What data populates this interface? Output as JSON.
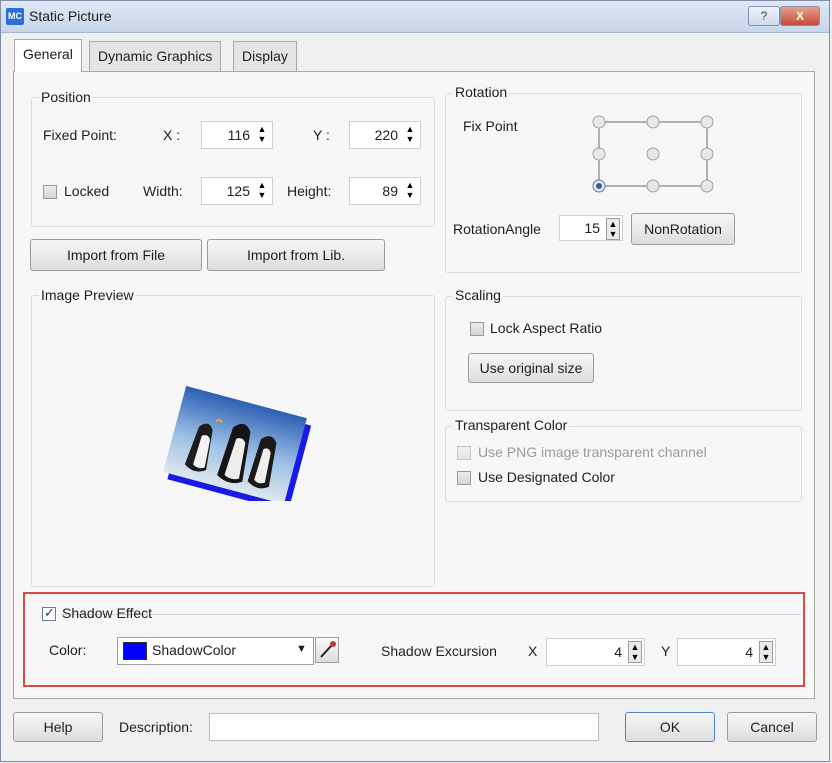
{
  "window": {
    "app_icon_text": "MC",
    "title": "Static Picture",
    "help_label": "?",
    "close_label": "X"
  },
  "tabs": [
    {
      "label": "General",
      "active": true
    },
    {
      "label": "Dynamic Graphics",
      "active": false
    },
    {
      "label": "Display",
      "active": false
    }
  ],
  "position": {
    "title": "Position",
    "fixed_point_label": "Fixed Point:",
    "x_label": "X :",
    "x_value": "116",
    "y_label": "Y :",
    "y_value": "220",
    "locked_label": "Locked",
    "locked_checked": false,
    "width_label": "Width:",
    "width_value": "125",
    "height_label": "Height:",
    "height_value": "89"
  },
  "import": {
    "from_file_label": "Import from File",
    "from_lib_label": "Import from Lib."
  },
  "rotation": {
    "title": "Rotation",
    "fix_point_label": "Fix Point",
    "selected_point": "bottom-left",
    "angle_label": "RotationAngle",
    "angle_value": "15",
    "non_rotation_label": "NonRotation"
  },
  "image_preview": {
    "title": "Image Preview"
  },
  "scaling": {
    "title": "Scaling",
    "lock_aspect_label": "Lock Aspect Ratio",
    "lock_aspect_checked": false,
    "original_size_label": "Use original size"
  },
  "transparent": {
    "title": "Transparent Color",
    "png_channel_label": "Use PNG image transparent channel",
    "png_channel_enabled": false,
    "designated_label": "Use Designated Color",
    "designated_checked": false
  },
  "shadow": {
    "effect_label": "Shadow Effect",
    "effect_checked": true,
    "color_label": "Color:",
    "color_name": "ShadowColor",
    "color_swatch": "#0000ff",
    "excursion_label": "Shadow Excursion",
    "x_label": "X",
    "x_value": "4",
    "y_label": "Y",
    "y_value": "4"
  },
  "footer": {
    "help_label": "Help",
    "description_label": "Description:",
    "description_value": "",
    "ok_label": "OK",
    "cancel_label": "Cancel"
  },
  "colors": {
    "highlight_border": "#d94a4a",
    "title_gradient_top": "#dfe8f4",
    "close_button": "#c44a34"
  }
}
